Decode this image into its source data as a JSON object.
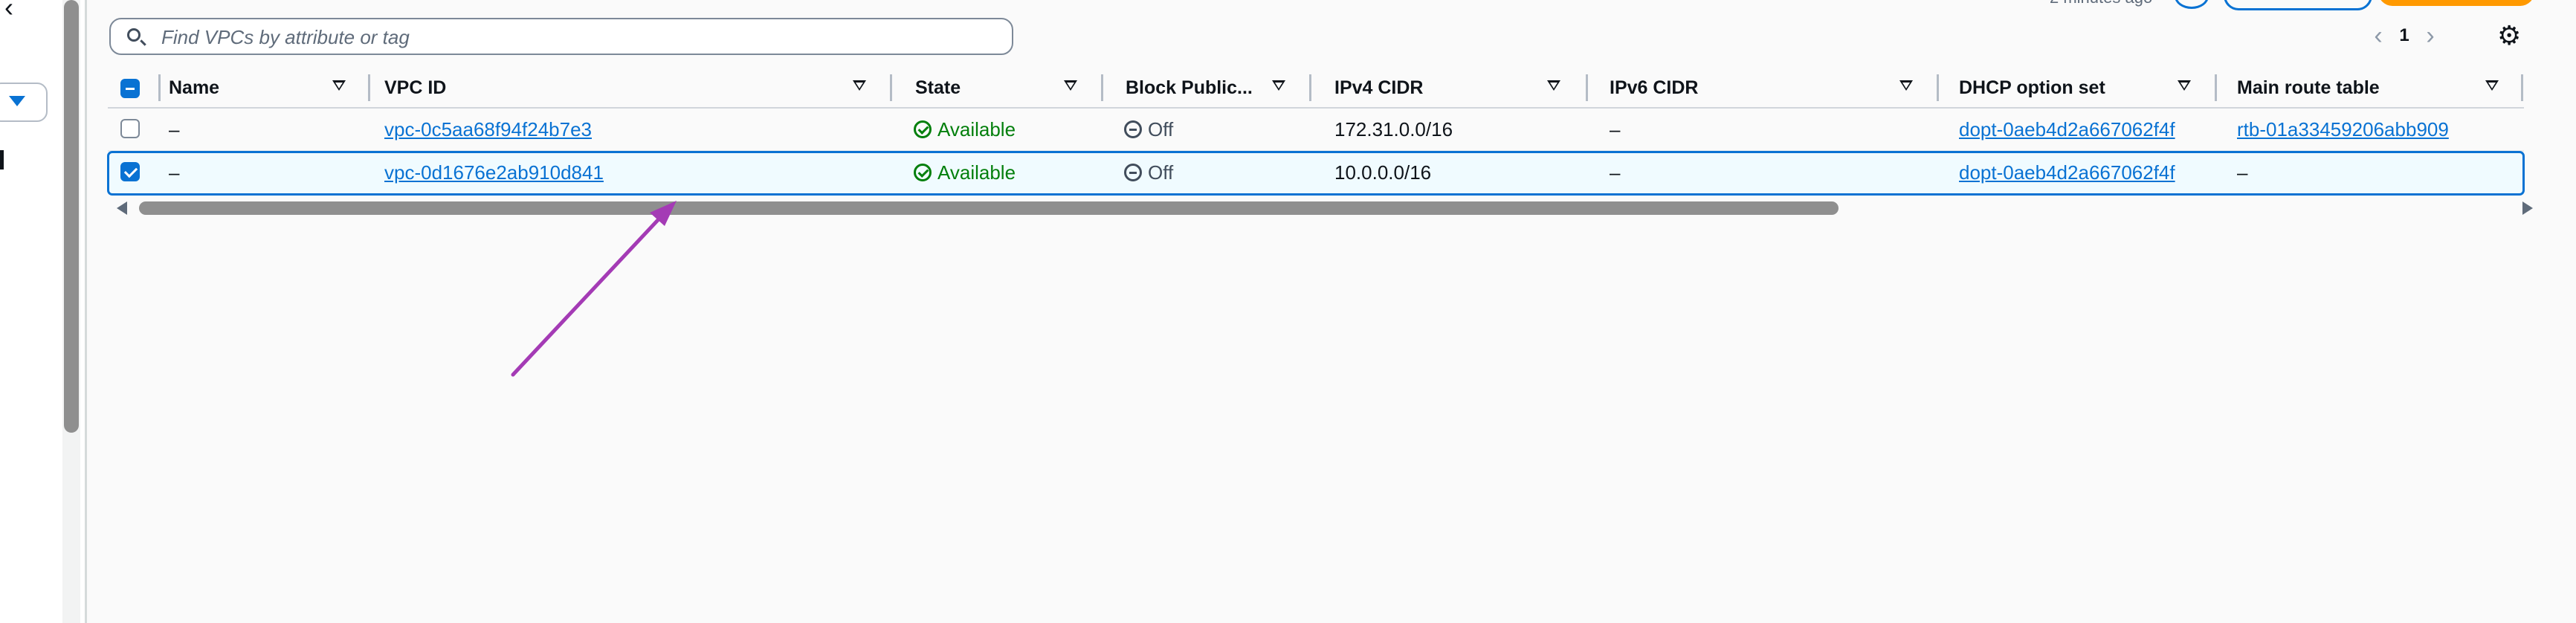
{
  "left_nav": {
    "back_icon": "chevron-left-icon",
    "select_icon": "caret-down-icon"
  },
  "header": {
    "search_placeholder": "Find VPCs by attribute or tag",
    "refresh_note": "2 minutes ago",
    "pagination": {
      "current_page": "1"
    },
    "settings_icon": "gear-icon"
  },
  "table": {
    "columns": [
      {
        "key": "name",
        "label": "Name"
      },
      {
        "key": "vpc_id",
        "label": "VPC ID"
      },
      {
        "key": "state",
        "label": "State"
      },
      {
        "key": "block_public",
        "label": "Block Public..."
      },
      {
        "key": "ipv4",
        "label": "IPv4 CIDR"
      },
      {
        "key": "ipv6",
        "label": "IPv6 CIDR"
      },
      {
        "key": "dhcp",
        "label": "DHCP option set"
      },
      {
        "key": "main_rt",
        "label": "Main route table"
      }
    ],
    "rows": [
      {
        "selected": false,
        "name": "–",
        "vpc_id": "vpc-0c5aa68f94f24b7e3",
        "state": "Available",
        "block_public": "Off",
        "ipv4": "172.31.0.0/16",
        "ipv6": "–",
        "dhcp": "dopt-0aeb4d2a667062f4f",
        "main_rt": "rtb-01a33459206abb909"
      },
      {
        "selected": true,
        "name": "–",
        "vpc_id": "vpc-0d1676e2ab910d841",
        "state": "Available",
        "block_public": "Off",
        "ipv4": "10.0.0.0/16",
        "ipv6": "–",
        "dhcp": "dopt-0aeb4d2a667062f4f",
        "main_rt": "–"
      }
    ]
  },
  "colors": {
    "link": "#0972d3",
    "available": "#037f0c",
    "selected_bg": "#f0fbff",
    "primary_button": "#ff9900",
    "annotation_arrow": "#a43bb5"
  }
}
